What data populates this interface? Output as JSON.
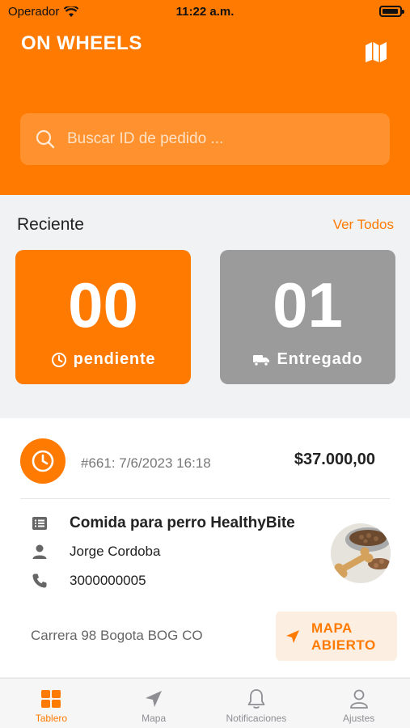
{
  "status_bar": {
    "carrier": "Operador",
    "time": "11:22 a.m."
  },
  "header": {
    "title": "ON WHEELS",
    "map_icon": "map-icon"
  },
  "search": {
    "placeholder": "Buscar ID de pedido ..."
  },
  "recent": {
    "title": "Reciente",
    "see_all": "Ver Todos",
    "cards": [
      {
        "count": "00",
        "label": "pendiente",
        "icon": "clock-icon",
        "color": "#ff7a00"
      },
      {
        "count": "01",
        "label": "Entregado",
        "icon": "truck-icon",
        "color": "#9b9b9b"
      }
    ]
  },
  "order": {
    "id_date": "#661: 7/6/2023 16:18",
    "price": "$37.000,00",
    "product": "Comida para perro HealthyBite",
    "customer": "Jorge Cordoba",
    "phone": "3000000005",
    "address": "Carrera 98 Bogota BOG CO",
    "map_button": "MAPA ABIERTO"
  },
  "tabs": [
    {
      "label": "Tablero",
      "icon": "grid-icon",
      "active": true
    },
    {
      "label": "Mapa",
      "icon": "navigation-arrow-icon",
      "active": false
    },
    {
      "label": "Notificaciones",
      "icon": "bell-icon",
      "active": false
    },
    {
      "label": "Ajustes",
      "icon": "user-icon",
      "active": false
    }
  ],
  "colors": {
    "accent": "#ff7a00",
    "delivered": "#9b9b9b",
    "background": "#f0f2f4"
  }
}
